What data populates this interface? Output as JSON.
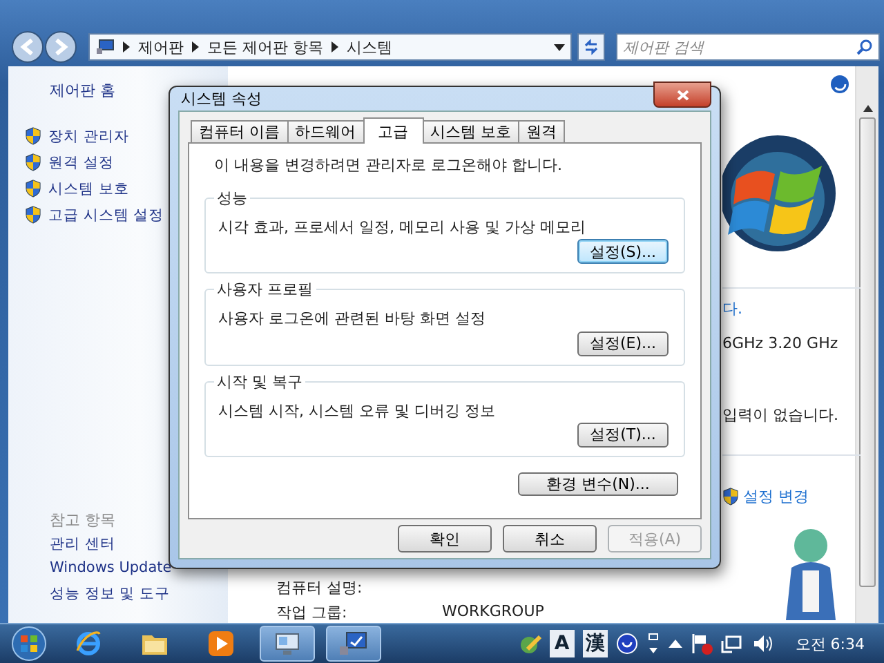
{
  "explorer": {
    "crumbs": [
      "제어판",
      "모든 제어판 항목",
      "시스템"
    ],
    "search": {
      "placeholder": "제어판 검색"
    }
  },
  "sidebar": {
    "home": "제어판 홈",
    "tasks": [
      "장치 관리자",
      "원격 설정",
      "시스템 보호",
      "고급 시스템 설정"
    ],
    "see_also": {
      "heading": "참고 항목",
      "links": [
        "관리 센터",
        "Windows Update",
        "성능 정보 및 도구"
      ]
    }
  },
  "main": {
    "right_texts": [
      {
        "kind": "link",
        "text": "다."
      },
      {
        "kind": "text",
        "text": "6GHz   3.20 GHz"
      },
      {
        "kind": "text",
        "text": "입력이 없습니다."
      }
    ],
    "change_link": "설정 변경",
    "rows": [
      {
        "label": "컴퓨터 설명:",
        "value": ""
      },
      {
        "label": "작업 그룹:",
        "value": "WORKGROUP"
      }
    ]
  },
  "dialog": {
    "title": "시스템 속성",
    "tabs": [
      {
        "label": "컴퓨터 이름",
        "selected": false
      },
      {
        "label": "하드웨어",
        "selected": false
      },
      {
        "label": "고급",
        "selected": true
      },
      {
        "label": "시스템 보호",
        "selected": false
      },
      {
        "label": "원격",
        "selected": false
      }
    ],
    "notice": "이 내용을 변경하려면 관리자로 로그온해야 합니다.",
    "groups": [
      {
        "title": "성능",
        "description": "시각 효과, 프로세서 일정, 메모리 사용 및 가상 메모리",
        "button": "설정(S)...",
        "focused": true
      },
      {
        "title": "사용자 프로필",
        "description": "사용자 로그온에 관련된 바탕 화면 설정",
        "button": "설정(E)...",
        "focused": false
      },
      {
        "title": "시작 및 복구",
        "description": "시스템 시작, 시스템 오류 및 디버깅 정보",
        "button": "설정(T)...",
        "focused": false
      }
    ],
    "env_button": "환경 변수(N)...",
    "buttons": [
      {
        "label": "확인",
        "disabled": false
      },
      {
        "label": "취소",
        "disabled": false
      },
      {
        "label": "적용(A)",
        "disabled": true
      }
    ]
  },
  "taskbar": {
    "apps": [
      {
        "kind": "browser",
        "active": false
      },
      {
        "kind": "folder",
        "active": false
      },
      {
        "kind": "media",
        "active": false
      },
      {
        "kind": "monitor",
        "active": true
      },
      {
        "kind": "settings",
        "active": true
      }
    ],
    "tray": {
      "ime_mode": "A",
      "hanja": "漢",
      "clock": "오전 6:34"
    }
  }
}
